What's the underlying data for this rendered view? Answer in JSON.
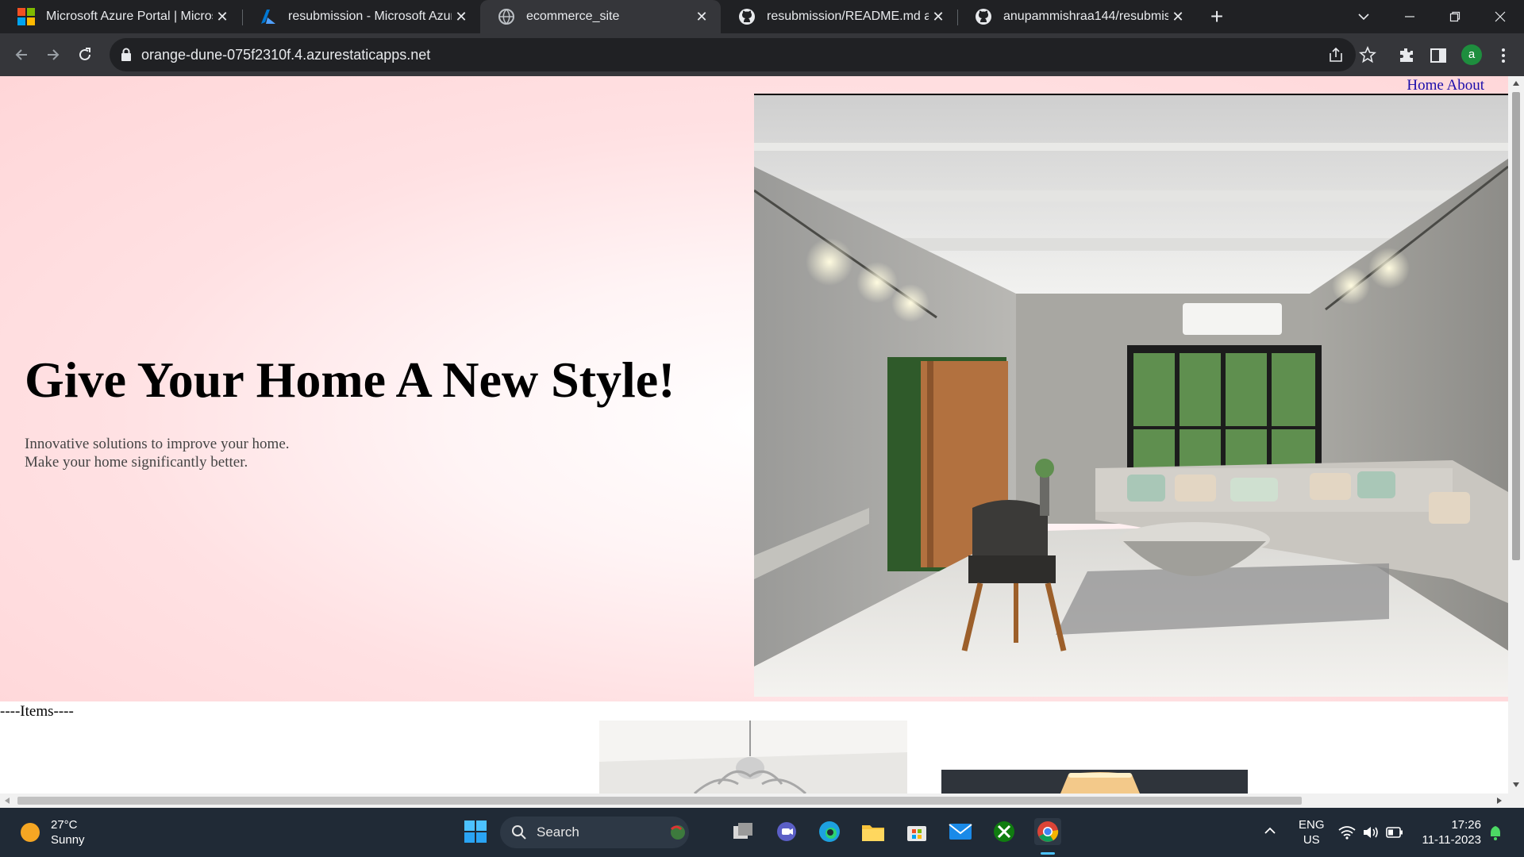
{
  "browser": {
    "tabs": [
      {
        "title": "Microsoft Azure Portal | Microso",
        "icon": "microsoft-icon"
      },
      {
        "title": "resubmission - Microsoft Azure",
        "icon": "azure-icon"
      },
      {
        "title": "ecommerce_site",
        "icon": "globe-icon",
        "active": true
      },
      {
        "title": "resubmission/README.md at m",
        "icon": "github-icon"
      },
      {
        "title": "anupammishraa144/resubmissio",
        "icon": "github-icon"
      }
    ],
    "url": "orange-dune-075f2310f.4.azurestaticapps.net",
    "profile_initial": "a"
  },
  "page": {
    "nav": {
      "home": "Home",
      "about": "About"
    },
    "hero": {
      "title": "Give Your Home A New Style!",
      "subtitle_line1": "Innovative solutions to improve your home.",
      "subtitle_line2": "Make your home significantly better."
    },
    "items_label": "----Items----"
  },
  "taskbar": {
    "weather_temp": "27°C",
    "weather_desc": "Sunny",
    "search_label": "Search",
    "lang_line1": "ENG",
    "lang_line2": "US",
    "time": "17:26",
    "date": "11-11-2023"
  },
  "colors": {
    "accent_link": "#1a0dab",
    "hero_pink": "#ffd6d8"
  }
}
